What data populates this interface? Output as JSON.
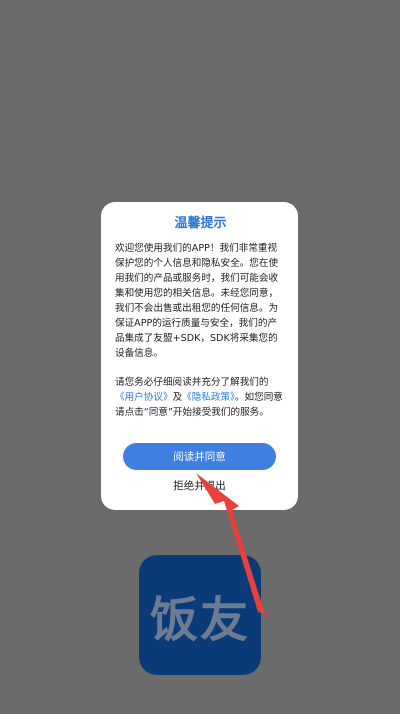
{
  "app_icon": {
    "label": "饭友"
  },
  "dialog": {
    "title": "温馨提示",
    "paragraph1": "欢迎您使用我们的APP！我们非常重视保护您的个人信息和隐私安全。您在使用我们的产品或服务时，我们可能会收集和使用您的相关信息。未经您同意，我们不会出售或出租您的任何信息。为保证APP的运行质量与安全，我们的产品集成了友盟+SDK，SDK将采集您的设备信息。",
    "p2_before": "请您务必仔细阅读并充分了解我们的",
    "user_agreement_link": "《用户协议》",
    "p2_and": "及",
    "privacy_policy_link": "《隐私政策》",
    "p2_after": "。如您同意请点击“同意”开始接受我们的服务。",
    "agree_button": "阅读并同意",
    "reject_link": "拒绝并退出"
  },
  "colors": {
    "overlay": "#6b6b6b",
    "accent": "#2f78d8",
    "button": "#3f7fe0",
    "arrow": "#e8413c",
    "app_icon_bg": "#0a3a78"
  }
}
